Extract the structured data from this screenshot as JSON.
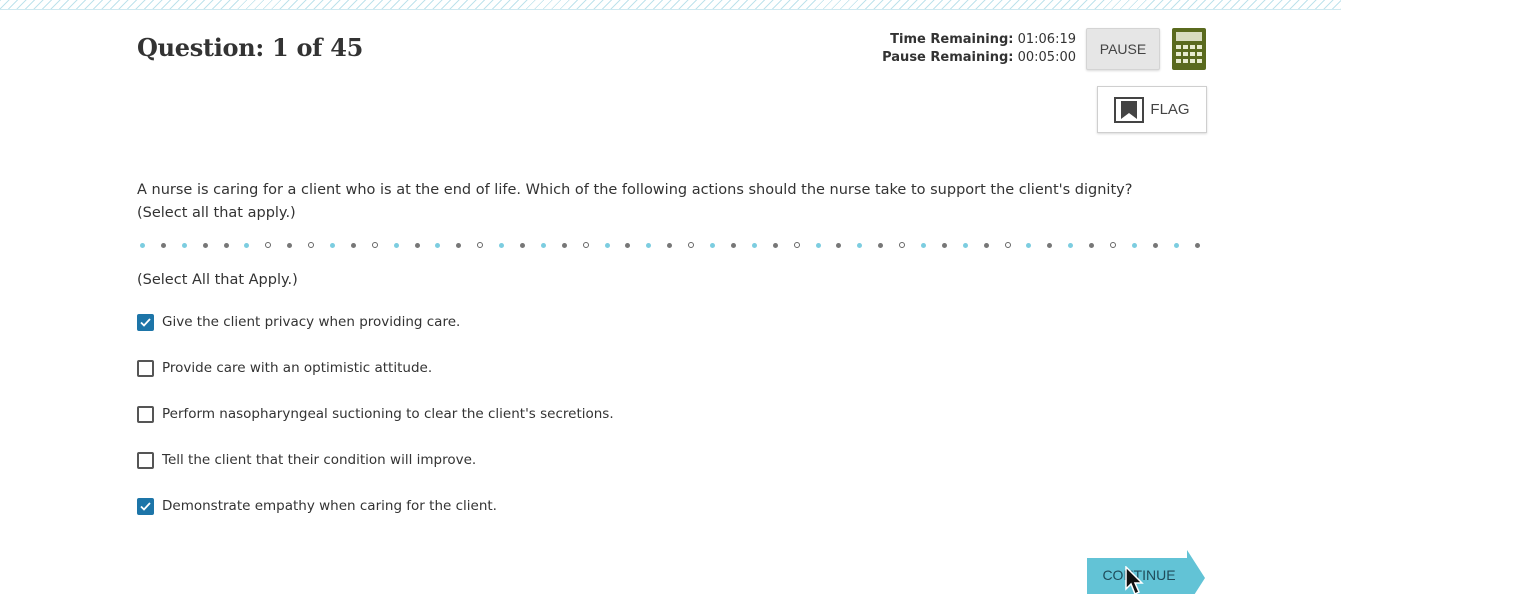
{
  "header": {
    "question_counter": "Question: 1 of 45",
    "time_remaining_label": "Time Remaining:",
    "time_remaining_value": "01:06:19",
    "pause_remaining_label": "Pause Remaining:",
    "pause_remaining_value": "00:05:00",
    "pause_button": "PAUSE",
    "calculator_icon": "calculator-icon",
    "flag_button": "FLAG",
    "flag_icon": "bookmark-flag-icon"
  },
  "question": {
    "stem": "A nurse is caring for a client who is at the end of life. Which of the following actions should the nurse take to support the client's dignity? (Select all that apply.)",
    "instruction": "(Select All that Apply.)",
    "options": [
      {
        "label": "Give the client privacy when providing care.",
        "checked": true
      },
      {
        "label": "Provide care with an optimistic attitude.",
        "checked": false
      },
      {
        "label": "Perform nasopharyngeal suctioning to clear the client's secretions.",
        "checked": false
      },
      {
        "label": "Tell the client that their condition will improve.",
        "checked": false
      },
      {
        "label": "Demonstrate empathy when caring for the client.",
        "checked": true
      }
    ]
  },
  "footer": {
    "continue_button": "CONTINUE"
  },
  "colors": {
    "accent_blue": "#1d75a8",
    "continue_teal": "#62c3d6",
    "calculator_green": "#5a6a1e"
  }
}
